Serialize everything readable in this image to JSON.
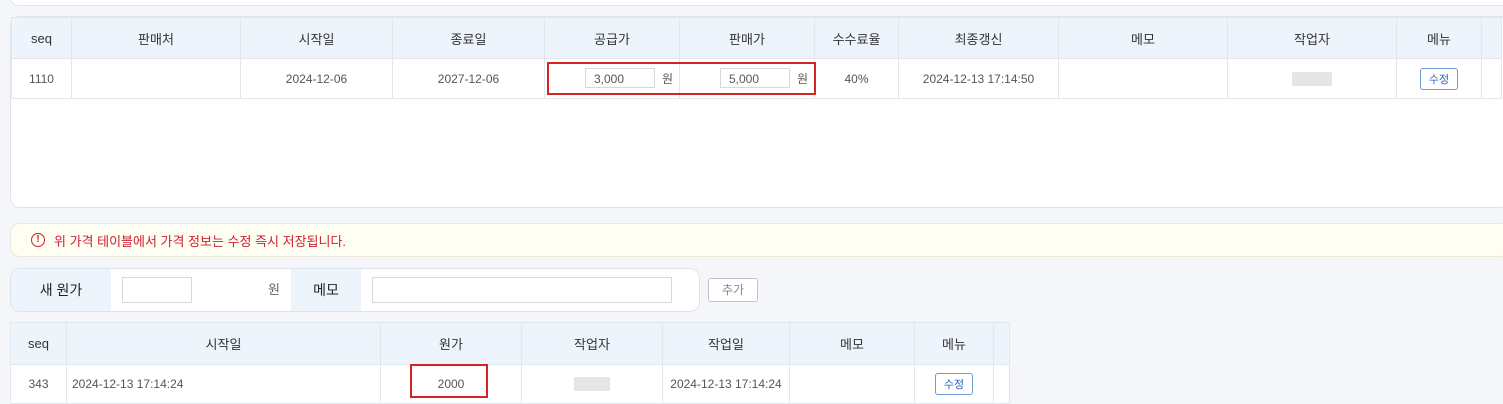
{
  "price_table": {
    "headers": [
      "seq",
      "판매처",
      "시작일",
      "종료일",
      "공급가",
      "판매가",
      "수수료율",
      "최종갱신",
      "메모",
      "작업자",
      "메뉴"
    ],
    "row": {
      "seq": "1110",
      "seller": "",
      "start_date": "2024-12-06",
      "end_date": "2027-12-06",
      "supply_price": "3,000",
      "supply_unit": "원",
      "sale_price": "5,000",
      "sale_unit": "원",
      "fee_rate": "40%",
      "last_updated": "2024-12-13 17:14:50",
      "memo": "",
      "edit_label": "수정"
    }
  },
  "notice": {
    "icon": "exclamation-circle-icon",
    "text": "위 가격 테이블에서 가격 정보는 수정 즉시 저장됩니다."
  },
  "cost_form": {
    "new_cost_label": "새 원가",
    "unit": "원",
    "memo_label": "메모",
    "add_label": "추가"
  },
  "cost_table": {
    "headers": [
      "seq",
      "시작일",
      "원가",
      "작업자",
      "작업일",
      "메모",
      "메뉴"
    ],
    "row": {
      "seq": "343",
      "start_date": "2024-12-13 17:14:24",
      "cost": "2000",
      "work_date": "2024-12-13 17:14:24",
      "memo": "",
      "edit_label": "수정"
    }
  },
  "colors": {
    "header_bg": "#eef4fc",
    "highlight": "#d42424",
    "notice_text": "#cf1e34",
    "button_border": "#6d9ad8"
  }
}
